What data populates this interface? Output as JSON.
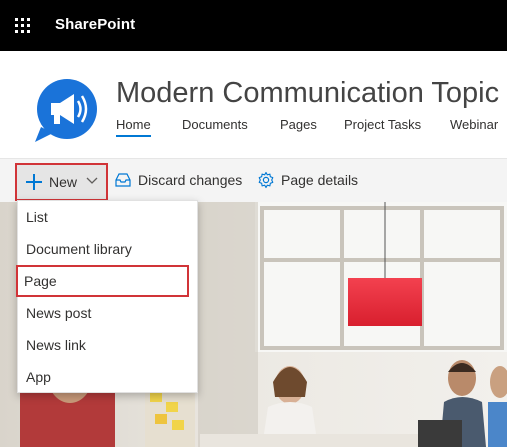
{
  "suite": {
    "title": "SharePoint"
  },
  "site": {
    "title": "Modern Communication Topic",
    "nav": [
      {
        "label": "Home",
        "active": true
      },
      {
        "label": "Documents",
        "active": false
      },
      {
        "label": "Pages",
        "active": false
      },
      {
        "label": "Project Tasks",
        "active": false
      },
      {
        "label": "Webinar",
        "active": false
      }
    ]
  },
  "commandbar": {
    "new_label": "New",
    "discard_label": "Discard changes",
    "details_label": "Page details"
  },
  "new_menu": {
    "items": [
      {
        "label": "List",
        "highlighted": false
      },
      {
        "label": "Document library",
        "highlighted": false
      },
      {
        "label": "Page",
        "highlighted": true
      },
      {
        "label": "News post",
        "highlighted": false
      },
      {
        "label": "News link",
        "highlighted": false
      },
      {
        "label": "App",
        "highlighted": false
      }
    ]
  },
  "colors": {
    "suitebar": "#000000",
    "accent": "#0078d4",
    "highlight_outline": "#d13438",
    "logo": "#1a73d9"
  }
}
